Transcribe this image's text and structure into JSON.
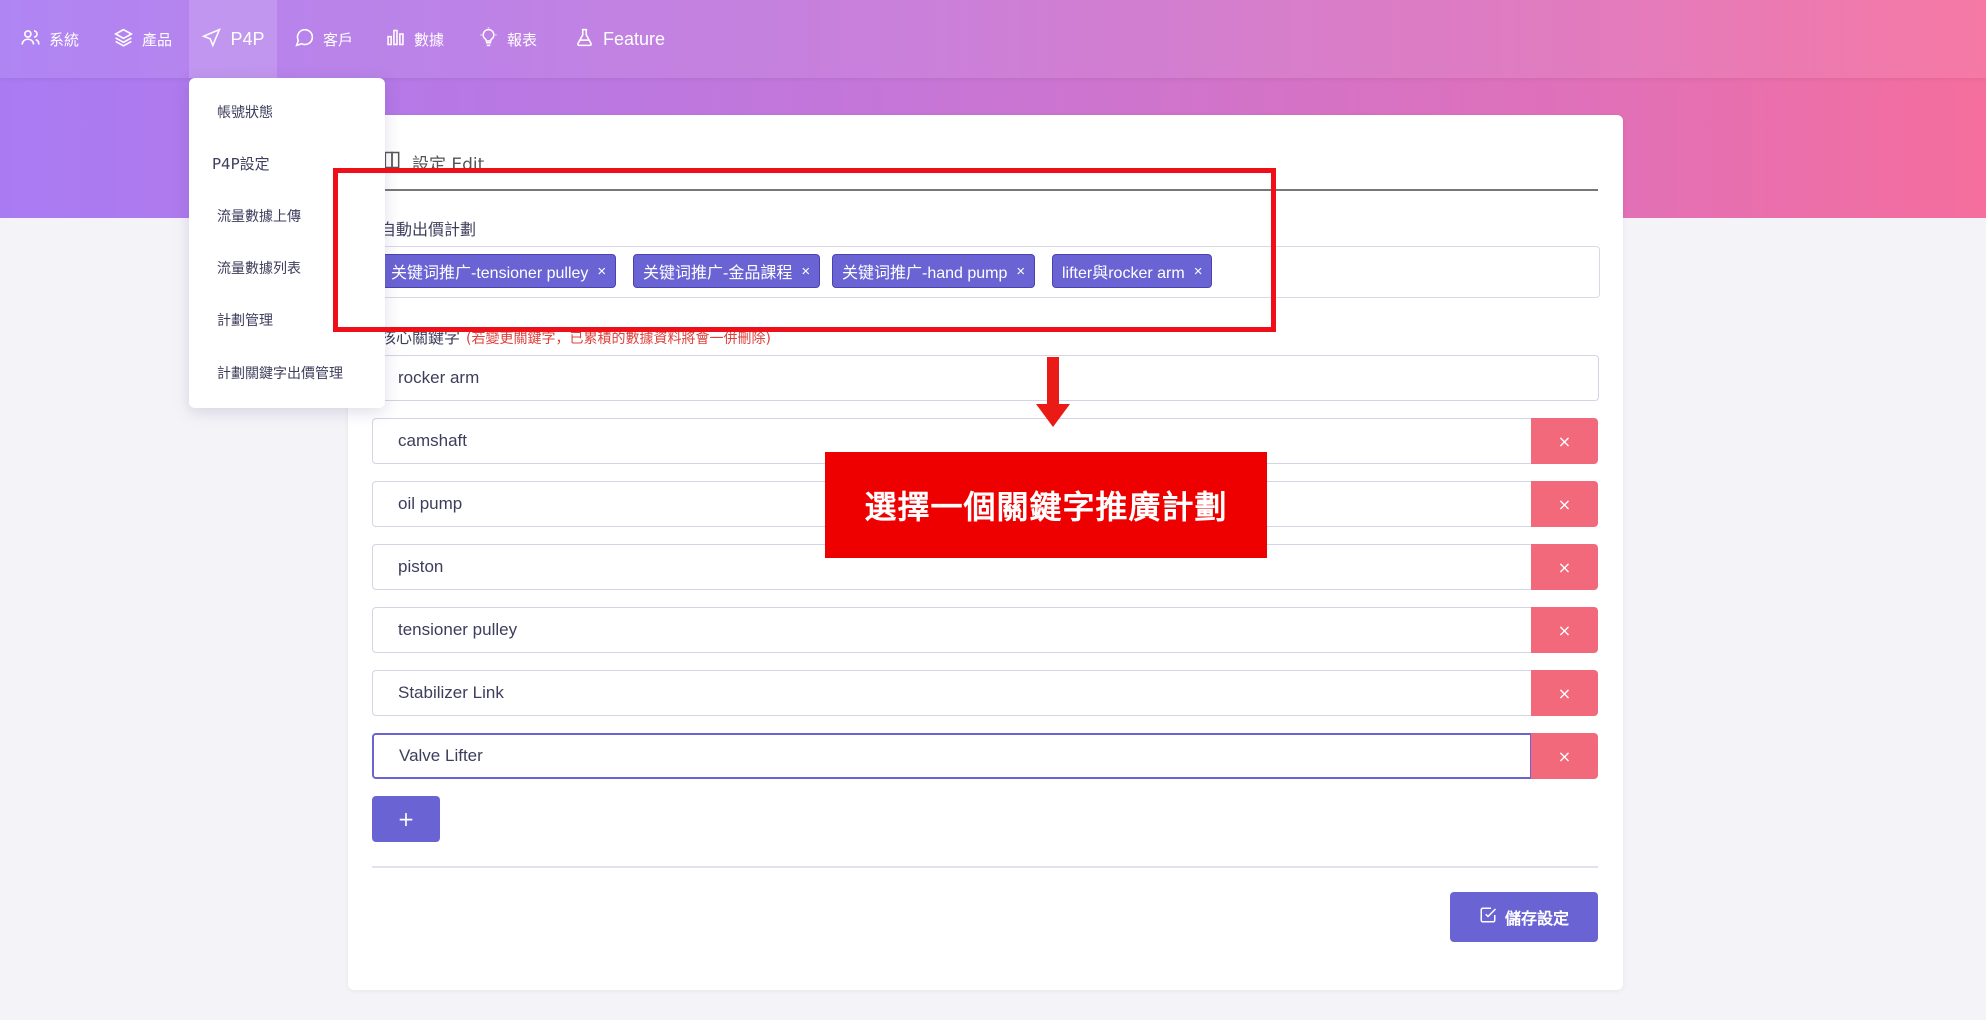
{
  "nav": {
    "items": [
      {
        "label": "系統",
        "icon": "users-icon"
      },
      {
        "label": "產品",
        "icon": "layers-icon"
      },
      {
        "label": "P4P",
        "icon": "navigation-icon"
      },
      {
        "label": "客戶",
        "icon": "message-circle-icon"
      },
      {
        "label": "數據",
        "icon": "bar-chart-icon"
      },
      {
        "label": "報表",
        "icon": "lightbulb-icon"
      },
      {
        "label": "Feature",
        "icon": "flask-icon"
      }
    ],
    "active": "P4P"
  },
  "dropdown": {
    "items": [
      "帳號狀態",
      "P4P設定",
      "流量數據上傳",
      "流量數據列表",
      "計劃管理",
      "計劃關鍵字出價管理"
    ]
  },
  "card": {
    "title": "設定 Edit",
    "plans_label": "自動出價計劃",
    "plans": [
      {
        "label": "关键词推广-tensioner pulley"
      },
      {
        "label": "关键词推广-金品課程"
      },
      {
        "label": "关键词推广-hand pump"
      },
      {
        "label": "lifter與rocker arm"
      }
    ],
    "keywords_label": "核心關鍵字",
    "keywords_hint": "(若變更關鍵字，已累積的數據資料將會一併刪除)",
    "keywords": [
      "rocker arm",
      "camshaft",
      "oil pump",
      "piston",
      "tensioner pulley",
      "Stabilizer Link",
      "Valve Lifter"
    ],
    "delete_symbol": "×",
    "add_symbol": "+",
    "save_label": "儲存設定"
  },
  "annotation": {
    "callout_text": "選擇一個關鍵字推廣計劃"
  },
  "colors": {
    "primary": "#6a63d3",
    "danger": "#f1697a",
    "annotation_red": "#ef0000"
  }
}
